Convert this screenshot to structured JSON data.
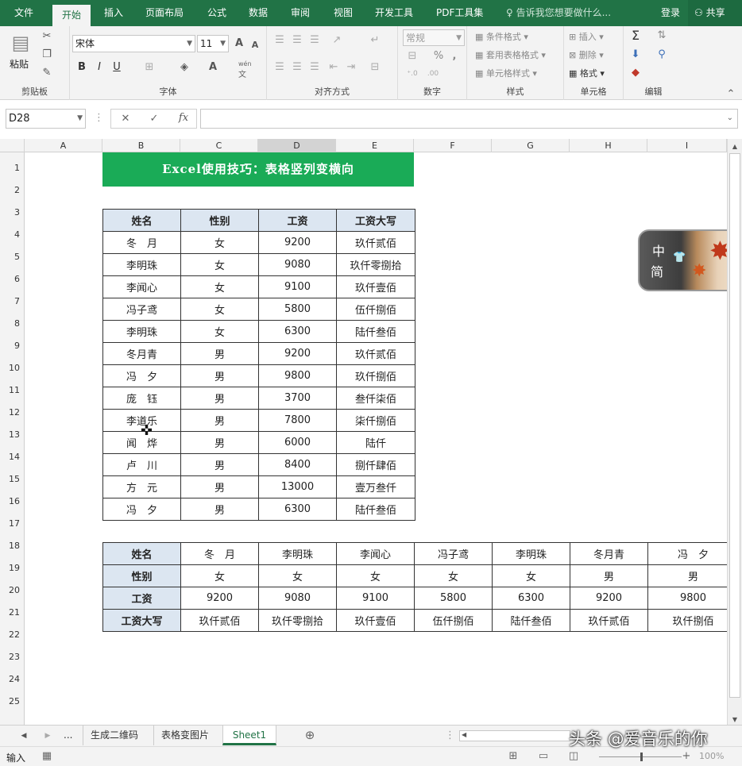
{
  "menu": {
    "file": "文件",
    "tabs": [
      "开始",
      "插入",
      "页面布局",
      "公式",
      "数据",
      "审阅",
      "视图",
      "开发工具",
      "PDF工具集"
    ],
    "tell_me": "告诉我您想要做什么...",
    "login": "登录",
    "share": "共享"
  },
  "ribbon": {
    "clipboard": {
      "label": "剪贴板",
      "paste": "粘贴"
    },
    "font": {
      "label": "字体",
      "name": "宋体",
      "size": "11",
      "bold": "B",
      "italic": "I",
      "underline": "U",
      "grow": "A",
      "shrink": "A",
      "wen": "wén",
      "wen_char": "文"
    },
    "alignment": {
      "label": "对齐方式"
    },
    "number": {
      "label": "数字",
      "format": "常规",
      "percent": "%",
      "comma": ","
    },
    "styles": {
      "label": "样式",
      "conditional": "条件格式",
      "table": "套用表格格式",
      "cell": "单元格样式"
    },
    "cells": {
      "label": "单元格",
      "insert": "插入",
      "delete": "删除",
      "format": "格式"
    },
    "editing": {
      "label": "编辑",
      "sigma": "Σ"
    }
  },
  "formula_bar": {
    "name_box": "D28",
    "fx": "fx",
    "value": ""
  },
  "columns": [
    "A",
    "B",
    "C",
    "D",
    "E",
    "F",
    "G",
    "H",
    "I"
  ],
  "rows": [
    "1",
    "2",
    "3",
    "4",
    "5",
    "6",
    "7",
    "8",
    "9",
    "10",
    "11",
    "12",
    "13",
    "14",
    "15",
    "16",
    "17",
    "18",
    "19",
    "20",
    "21",
    "22",
    "23",
    "24",
    "25"
  ],
  "title": "Excel使用技巧：表格竖列变横向",
  "table1": {
    "headers": [
      "姓名",
      "性别",
      "工资",
      "工资大写"
    ],
    "rows": [
      [
        "冬　月",
        "女",
        "9200",
        "玖仟贰佰"
      ],
      [
        "李明珠",
        "女",
        "9080",
        "玖仟零捌拾"
      ],
      [
        "李闻心",
        "女",
        "9100",
        "玖仟壹佰"
      ],
      [
        "冯子鸢",
        "女",
        "5800",
        "伍仟捌佰"
      ],
      [
        "李明珠",
        "女",
        "6300",
        "陆仟叁佰"
      ],
      [
        "冬月青",
        "男",
        "9200",
        "玖仟贰佰"
      ],
      [
        "冯　夕",
        "男",
        "9800",
        "玖仟捌佰"
      ],
      [
        "庞　钰",
        "男",
        "3700",
        "叁仟柒佰"
      ],
      [
        "李道乐",
        "男",
        "7800",
        "柒仟捌佰"
      ],
      [
        "闻　烨",
        "男",
        "6000",
        "陆仟"
      ],
      [
        "卢　川",
        "男",
        "8400",
        "捌仟肆佰"
      ],
      [
        "方　元",
        "男",
        "13000",
        "壹万叁仟"
      ],
      [
        "冯　夕",
        "男",
        "6300",
        "陆仟叁佰"
      ]
    ]
  },
  "table2": {
    "rows": [
      [
        "姓名",
        "冬　月",
        "李明珠",
        "李闻心",
        "冯子鸢",
        "李明珠",
        "冬月青",
        "冯　夕"
      ],
      [
        "性别",
        "女",
        "女",
        "女",
        "女",
        "女",
        "男",
        "男"
      ],
      [
        "工资",
        "9200",
        "9080",
        "9100",
        "5800",
        "6300",
        "9200",
        "9800"
      ],
      [
        "工资大写",
        "玖仟贰佰",
        "玖仟零捌拾",
        "玖仟壹佰",
        "伍仟捌佰",
        "陆仟叁佰",
        "玖仟贰佰",
        "玖仟捌佰"
      ]
    ]
  },
  "float_widget": {
    "zh": "中",
    "jian": "简"
  },
  "sheet_tabs": {
    "more": "...",
    "tabs": [
      "生成二维码",
      "表格变图片",
      "Sheet1"
    ]
  },
  "status": {
    "mode": "输入",
    "zoom": "100%",
    "watermark": "头条 @爱音乐的你"
  },
  "colors": {
    "excel_green": "#217346",
    "title_green": "#1aab57",
    "header_fill": "#dce6f1",
    "active_tab": "#217346"
  }
}
